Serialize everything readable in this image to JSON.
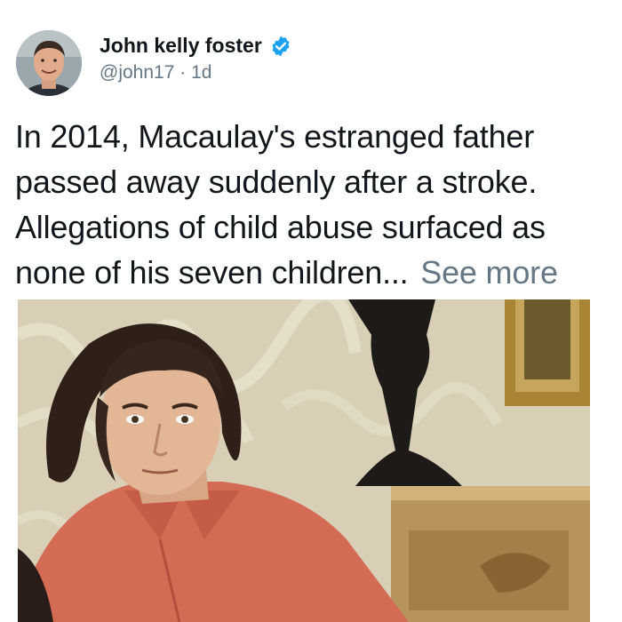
{
  "tweet": {
    "author": {
      "display_name": "John kelly foster",
      "handle": "@john17",
      "separator": "·",
      "age": "1d",
      "avatar_icon": "profile-photo",
      "verified_icon": "verified-badge-icon",
      "verified_color": "#1da1f2"
    },
    "text": "In 2014, Macaulay's estranged father passed away suddenly after a stroke. Allegations of child abuse surfaced as none of his seven children...",
    "see_more_label": "See more",
    "media": {
      "kind": "photo"
    }
  },
  "colors": {
    "text_primary": "#14171a",
    "text_secondary": "#657786",
    "background": "#ffffff"
  }
}
